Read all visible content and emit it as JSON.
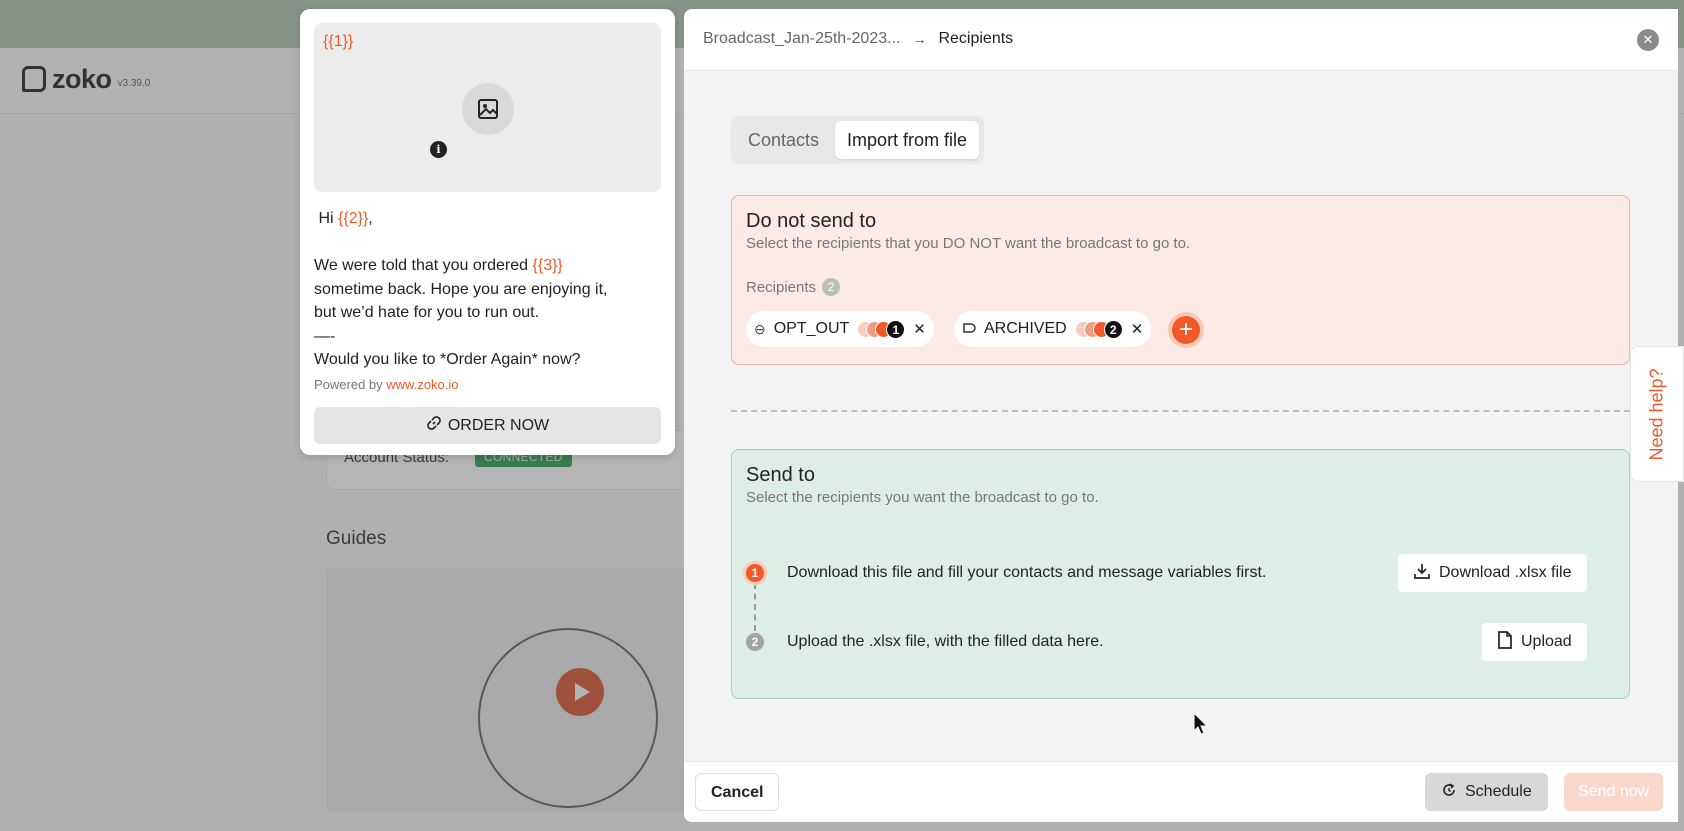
{
  "app": {
    "logo_text": "zoko",
    "version": "v3.39.0"
  },
  "background": {
    "account_status_label": "Account Status:",
    "account_status_value": "CONNECTED",
    "guides_title": "Guides"
  },
  "preview": {
    "var1": "{{1}}",
    "greeting_prefix": "Hi ",
    "var2": "{{2}}",
    "greeting_suffix": ",",
    "line1_prefix": "We were told that you ordered ",
    "var3": "{{3}}",
    "line2": "sometime back. Hope you are enjoying it,",
    "line3": "but we’d hate for you to run out.",
    "line4": "—-",
    "line5": "Would you like to *Order Again* now?",
    "powered_prefix": "Powered by ",
    "powered_link": "www.zoko.io",
    "order_button": "ORDER NOW"
  },
  "drawer": {
    "breadcrumb": [
      "Broadcast_Jan-25th-2023...",
      "Recipients"
    ],
    "tabs": [
      {
        "label": "Contacts",
        "active": false
      },
      {
        "label": "Import from file",
        "active": true
      }
    ],
    "do_not_send": {
      "title": "Do not send to",
      "subtitle": "Select the recipients that you DO NOT want the broadcast to go to.",
      "recipients_label": "Recipients",
      "recipients_count": "2",
      "chips": [
        {
          "label": "OPT_OUT",
          "count": "1",
          "icon": "opt-out-icon"
        },
        {
          "label": "ARCHIVED",
          "count": "2",
          "icon": "archive-icon"
        }
      ]
    },
    "send_to": {
      "title": "Send to",
      "subtitle": "Select the recipients you want the broadcast to go to.",
      "steps": [
        {
          "num": "1",
          "text": "Download this file and fill your contacts and message variables first.",
          "button": "Download .xlsx file"
        },
        {
          "num": "2",
          "text": "Upload the .xlsx file, with the filled data here.",
          "button": "Upload"
        }
      ]
    },
    "footer": {
      "cancel": "Cancel",
      "schedule": "Schedule",
      "send_now": "Send now"
    }
  },
  "need_help": "Need help?",
  "colors": {
    "accent": "#f05a2a",
    "do_not_send_bg": "#fceae6",
    "send_to_bg": "#ddeee6",
    "connected": "#1e9a4a"
  }
}
